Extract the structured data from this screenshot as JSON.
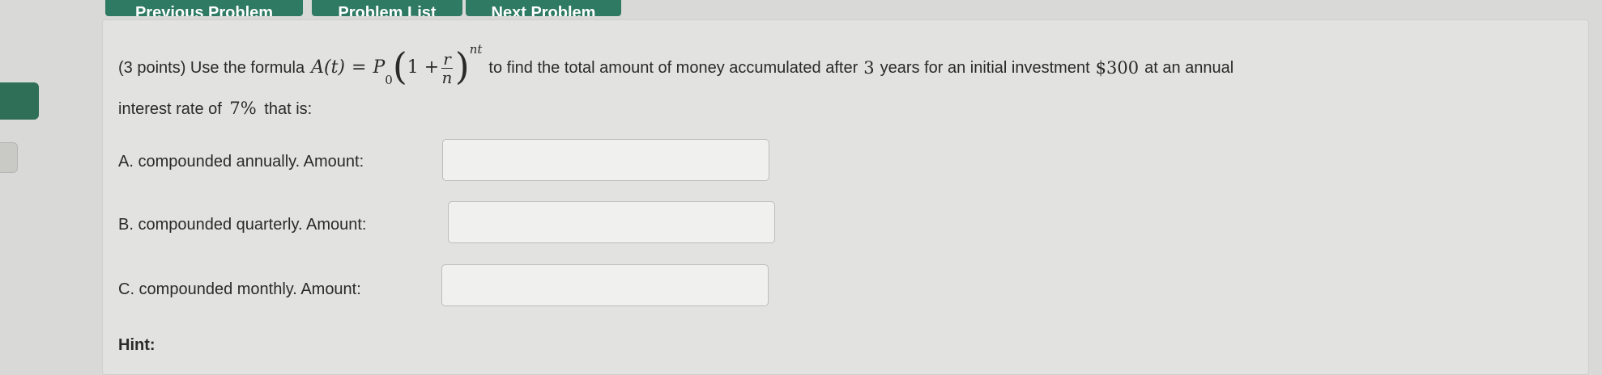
{
  "nav": {
    "prev_label": "Previous Problem",
    "list_label": "Problem List",
    "next_label": "Next Problem"
  },
  "question": {
    "points": "(3 points) Use the formula",
    "formula": {
      "lhs": "A(t)",
      "eq": "=",
      "p": "P",
      "p_sub": "0",
      "one_plus": "1 +",
      "frac_num": "r",
      "frac_den": "n",
      "exponent": "nt"
    },
    "text_after_formula": "to find the total amount of money accumulated after",
    "years_value": "3",
    "text_years": "years for an initial investment",
    "investment_value": "$300",
    "text_annual": "at an annual",
    "line2_prefix": "interest rate of",
    "rate_value": "7%",
    "line2_suffix": "that is:"
  },
  "parts": {
    "a_label": "A. compounded annually. Amount:",
    "b_label": "B. compounded quarterly. Amount:",
    "c_label": "C. compounded monthly. Amount:",
    "a_value": "",
    "b_value": "",
    "c_value": ""
  },
  "hint_label": "Hint:"
}
